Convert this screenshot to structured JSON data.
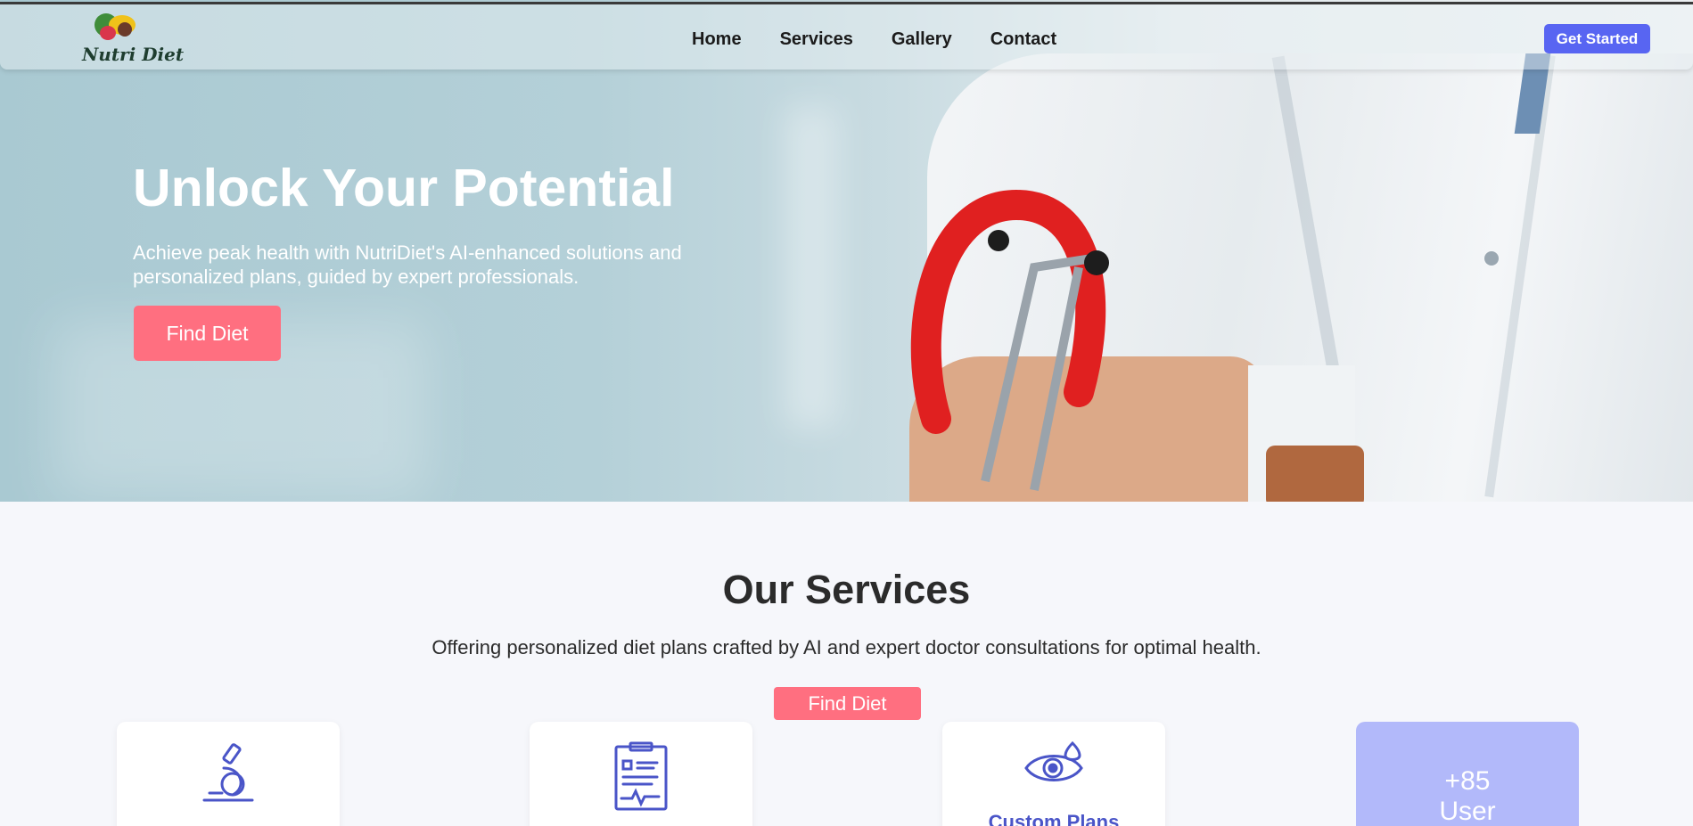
{
  "brand": {
    "name": "Nutri Diet"
  },
  "nav": {
    "links": [
      "Home",
      "Services",
      "Gallery",
      "Contact"
    ],
    "cta": "Get Started"
  },
  "hero": {
    "title": "Unlock Your Potential",
    "subtitle": "Achieve peak health with NutriDiet's AI-enhanced solutions and personalized plans, guided by expert professionals.",
    "button": "Find Diet"
  },
  "services": {
    "title": "Our Services",
    "subtitle": "Offering personalized diet plans crafted by AI and expert doctor consultations for optimal health.",
    "button": "Find Diet",
    "cards": [
      {
        "icon": "microscope-icon",
        "label": ""
      },
      {
        "icon": "clipboard-icon",
        "label": ""
      },
      {
        "icon": "eye-icon",
        "label": "Custom Plans"
      }
    ],
    "stat": {
      "value": "+85",
      "label": "User"
    }
  },
  "colors": {
    "accent": "#5865f2",
    "cta_pink": "#ff6f80",
    "icon_blue": "#4a55c8",
    "stat_bg": "#b2b9fa"
  }
}
